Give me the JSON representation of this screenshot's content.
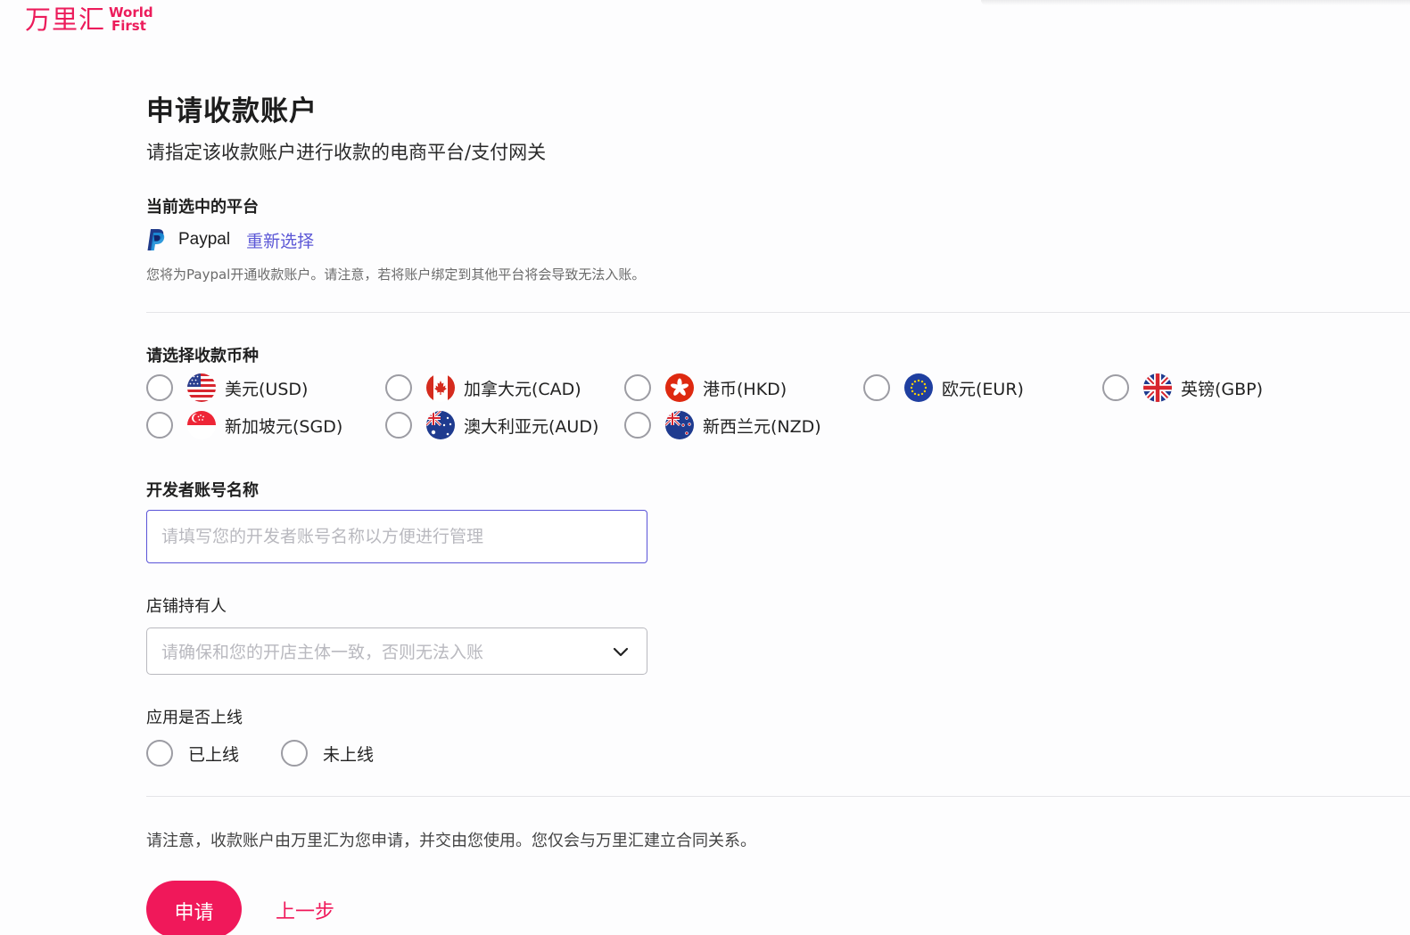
{
  "brand": {
    "name_cn": "万里汇",
    "name_en_line1": "World",
    "name_en_line2": "First",
    "color": "#ec1c5b"
  },
  "page": {
    "title": "申请收款账户",
    "subtitle": "请指定该收款账户进行收款的电商平台/支付网关"
  },
  "platform": {
    "label": "当前选中的平台",
    "name": "Paypal",
    "icon": "paypal-icon",
    "reselect_label": "重新选择",
    "note": "您将为Paypal开通收款账户。请注意，若将账户绑定到其他平台将会导致无法入账。"
  },
  "currency": {
    "label": "请选择收款币种",
    "options": [
      {
        "label": "美元(USD)",
        "flag": "us-flag-icon"
      },
      {
        "label": "加拿大元(CAD)",
        "flag": "ca-flag-icon"
      },
      {
        "label": "港币(HKD)",
        "flag": "hk-flag-icon"
      },
      {
        "label": "欧元(EUR)",
        "flag": "eu-flag-icon"
      },
      {
        "label": "英镑(GBP)",
        "flag": "gb-flag-icon"
      },
      {
        "label": "新加坡元(SGD)",
        "flag": "sg-flag-icon"
      },
      {
        "label": "澳大利亚元(AUD)",
        "flag": "au-flag-icon"
      },
      {
        "label": "新西兰元(NZD)",
        "flag": "nz-flag-icon"
      }
    ]
  },
  "developer_account": {
    "label": "开发者账号名称",
    "value": "",
    "placeholder": "请填写您的开发者账号名称以方便进行管理"
  },
  "store_owner": {
    "label": "店铺持有人",
    "placeholder": "请确保和您的开店主体一致，否则无法入账"
  },
  "online_status": {
    "label": "应用是否上线",
    "options": [
      {
        "label": "已上线"
      },
      {
        "label": "未上线"
      }
    ]
  },
  "footer": {
    "note": "请注意，收款账户由万里汇为您申请，并交由您使用。您仅会与万里汇建立合同关系。",
    "apply_label": "申请",
    "back_label": "上一步"
  },
  "colors": {
    "accent": "#f0185a",
    "link": "#5b57d6",
    "focus_border": "#5a54d8"
  }
}
